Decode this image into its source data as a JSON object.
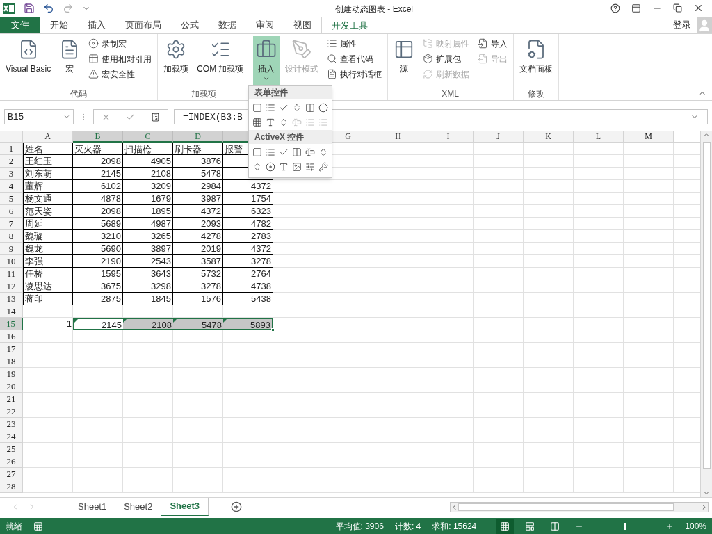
{
  "title_bar": {
    "title": "创建动态图表 - Excel"
  },
  "menu_tabs": [
    {
      "label": "文件",
      "kind": "file",
      "selected": false
    },
    {
      "label": "开始",
      "kind": "tab",
      "selected": false
    },
    {
      "label": "插入",
      "kind": "tab",
      "selected": false
    },
    {
      "label": "页面布局",
      "kind": "tab",
      "selected": false
    },
    {
      "label": "公式",
      "kind": "tab",
      "selected": false
    },
    {
      "label": "数据",
      "kind": "tab",
      "selected": false
    },
    {
      "label": "审阅",
      "kind": "tab",
      "selected": false
    },
    {
      "label": "视图",
      "kind": "tab",
      "selected": false
    },
    {
      "label": "开发工具",
      "kind": "tab",
      "selected": true
    }
  ],
  "account": {
    "label": "登录"
  },
  "ribbon_groups": [
    {
      "label": "代码",
      "columns": [
        [
          {
            "label": "Visual Basic",
            "kind": "large",
            "disabled": false,
            "pressed": false
          }
        ],
        [
          {
            "label": "宏",
            "kind": "large",
            "disabled": false,
            "pressed": false
          }
        ],
        [
          {
            "label": "录制宏",
            "kind": "small",
            "disabled": false,
            "pressed": false
          },
          {
            "label": "使用相对引用",
            "kind": "small",
            "disabled": false,
            "pressed": false
          },
          {
            "label": "宏安全性",
            "kind": "small",
            "disabled": false,
            "pressed": false
          }
        ]
      ]
    },
    {
      "label": "加载项",
      "columns": [
        [
          {
            "label": "加载项",
            "kind": "large",
            "disabled": false,
            "pressed": false
          }
        ],
        [
          {
            "label": "COM 加载项",
            "kind": "large",
            "disabled": false,
            "pressed": false
          }
        ]
      ]
    },
    {
      "columns": [
        [
          {
            "label": "插入",
            "kind": "large",
            "disabled": false,
            "pressed": true
          }
        ],
        [
          {
            "label": "设计模式",
            "kind": "large",
            "disabled": true,
            "pressed": false
          }
        ],
        [
          {
            "label": "属性",
            "kind": "small",
            "disabled": false,
            "pressed": false
          },
          {
            "label": "查看代码",
            "kind": "small",
            "disabled": false,
            "pressed": false
          },
          {
            "label": "执行对话框",
            "kind": "small",
            "disabled": false,
            "pressed": false
          }
        ]
      ]
    },
    {
      "label": "XML",
      "columns": [
        [
          {
            "label": "源",
            "kind": "large",
            "disabled": false,
            "pressed": false
          }
        ],
        [
          {
            "label": "映射属性",
            "kind": "small",
            "disabled": true,
            "pressed": false
          },
          {
            "label": "扩展包",
            "kind": "small",
            "disabled": false,
            "pressed": false
          },
          {
            "label": "刷新数据",
            "kind": "small",
            "disabled": true,
            "pressed": false
          }
        ],
        [
          {
            "label": "导入",
            "kind": "small",
            "disabled": false,
            "pressed": false
          },
          {
            "label": "导出",
            "kind": "small",
            "disabled": true,
            "pressed": false
          }
        ]
      ]
    },
    {
      "label": "修改",
      "columns": [
        [
          {
            "label": "文档面板",
            "kind": "large",
            "disabled": false,
            "pressed": false
          }
        ]
      ]
    }
  ],
  "insert_menu": {
    "sections": [
      {
        "title": "表单控件",
        "controls": [
          {
            "disabled": false
          },
          {
            "disabled": false
          },
          {
            "disabled": false
          },
          {
            "disabled": false
          },
          {
            "disabled": false
          },
          {
            "disabled": false
          },
          {
            "disabled": false
          },
          {
            "disabled": false
          },
          {
            "disabled": false
          },
          {
            "disabled": true
          },
          {
            "disabled": true
          },
          {
            "disabled": true
          }
        ]
      },
      {
        "title": "ActiveX 控件",
        "controls": [
          {
            "disabled": false
          },
          {
            "disabled": false
          },
          {
            "disabled": false
          },
          {
            "disabled": false
          },
          {
            "disabled": false
          },
          {
            "disabled": false
          },
          {
            "disabled": false
          },
          {
            "disabled": false
          },
          {
            "disabled": false
          },
          {
            "disabled": false
          },
          {
            "disabled": false
          },
          {
            "disabled": false
          }
        ]
      }
    ]
  },
  "formula_bar": {
    "name_box": "B15",
    "formula": "=INDEX(B3:B"
  },
  "columns": [
    {
      "label": "A",
      "selected": false
    },
    {
      "label": "B",
      "selected": true
    },
    {
      "label": "C",
      "selected": true
    },
    {
      "label": "D",
      "selected": true
    },
    {
      "selected": true
    },
    null,
    {
      "label": "G",
      "selected": false
    },
    {
      "label": "H",
      "selected": false
    },
    {
      "label": "I",
      "selected": false
    },
    {
      "label": "J",
      "selected": false
    },
    {
      "label": "K",
      "selected": false
    },
    {
      "label": "L",
      "selected": false
    },
    {
      "label": "M",
      "selected": false
    }
  ],
  "rows": [
    {
      "number": "1",
      "kind": "header",
      "selected": false,
      "cells": [
        "姓名",
        "灭火器",
        "扫描枪",
        "刷卡器",
        "报警"
      ]
    },
    {
      "number": "2",
      "kind": "data",
      "selected": false,
      "cells": [
        "王红玉",
        "2098",
        "4905",
        "3876",
        null
      ]
    },
    {
      "number": "3",
      "kind": "data",
      "selected": false,
      "cells": [
        "刘东萌",
        "2145",
        "2108",
        "5478",
        null
      ]
    },
    {
      "number": "4",
      "kind": "data",
      "selected": false,
      "cells": [
        "董辉",
        "6102",
        "3209",
        "2984",
        "4372"
      ]
    },
    {
      "number": "5",
      "kind": "data",
      "selected": false,
      "cells": [
        "杨文通",
        "4878",
        "1679",
        "3987",
        "1754"
      ]
    },
    {
      "number": "6",
      "kind": "data",
      "selected": false,
      "cells": [
        "范天姿",
        "2098",
        "1895",
        "4372",
        "6323"
      ]
    },
    {
      "number": "7",
      "kind": "data",
      "selected": false,
      "cells": [
        "周延",
        "5689",
        "4987",
        "2093",
        "4782"
      ]
    },
    {
      "number": "8",
      "kind": "data",
      "selected": false,
      "cells": [
        "魏璇",
        "3210",
        "3265",
        "4278",
        "2783"
      ]
    },
    {
      "number": "9",
      "kind": "data",
      "selected": false,
      "cells": [
        "魏龙",
        "5690",
        "3897",
        "2019",
        "4372"
      ]
    },
    {
      "number": "10",
      "kind": "data",
      "selected": false,
      "cells": [
        "李强",
        "2190",
        "2543",
        "3587",
        "3278"
      ]
    },
    {
      "number": "11",
      "kind": "data",
      "selected": false,
      "cells": [
        "任桥",
        "1595",
        "3643",
        "5732",
        "2764"
      ]
    },
    {
      "number": "12",
      "kind": "data",
      "selected": false,
      "cells": [
        "凌思达",
        "3675",
        "3298",
        "3278",
        "4738"
      ]
    },
    {
      "number": "13",
      "kind": "data",
      "selected": false,
      "cells": [
        "蒋印",
        "2875",
        "1845",
        "1576",
        "5438"
      ]
    },
    {
      "number": "14",
      "kind": "blank",
      "selected": false,
      "cells": []
    },
    {
      "number": "15",
      "kind": "result",
      "selected": true,
      "flagged": true,
      "cells": [
        "1",
        "2145",
        "2108",
        "5478",
        "5893"
      ]
    },
    {
      "number": "16",
      "kind": "blank",
      "selected": false,
      "cells": []
    },
    {
      "number": "17",
      "kind": "blank",
      "selected": false,
      "cells": []
    },
    {
      "number": "18",
      "kind": "blank",
      "selected": false,
      "cells": []
    },
    {
      "number": "19",
      "kind": "blank",
      "selected": false,
      "cells": []
    },
    {
      "number": "20",
      "kind": "blank",
      "selected": false,
      "cells": []
    },
    {
      "number": "21",
      "kind": "blank",
      "selected": false,
      "cells": []
    },
    {
      "number": "22",
      "kind": "blank",
      "selected": false,
      "cells": []
    },
    {
      "number": "23",
      "kind": "blank",
      "selected": false,
      "cells": []
    },
    {
      "number": "24",
      "kind": "blank",
      "selected": false,
      "cells": []
    },
    {
      "number": "25",
      "kind": "blank",
      "selected": false,
      "cells": []
    },
    {
      "number": "26",
      "kind": "blank",
      "selected": false,
      "cells": []
    },
    {
      "number": "27",
      "kind": "blank",
      "selected": false,
      "cells": []
    },
    {
      "number": "28",
      "kind": "blank",
      "selected": false,
      "cells": []
    }
  ],
  "sheet_tabs": [
    {
      "label": "Sheet1",
      "selected": false
    },
    {
      "label": "Sheet2",
      "selected": false
    },
    {
      "label": "Sheet3",
      "selected": true
    }
  ],
  "status_bar": {
    "status": "就绪",
    "stats": [
      "平均值: 3906",
      "计数: 4",
      "求和: 15624"
    ],
    "views": [
      {
        "selected": true
      },
      {
        "selected": false
      },
      {
        "selected": false
      }
    ],
    "zoom": {
      "level": 0.5,
      "label": "100%"
    }
  }
}
